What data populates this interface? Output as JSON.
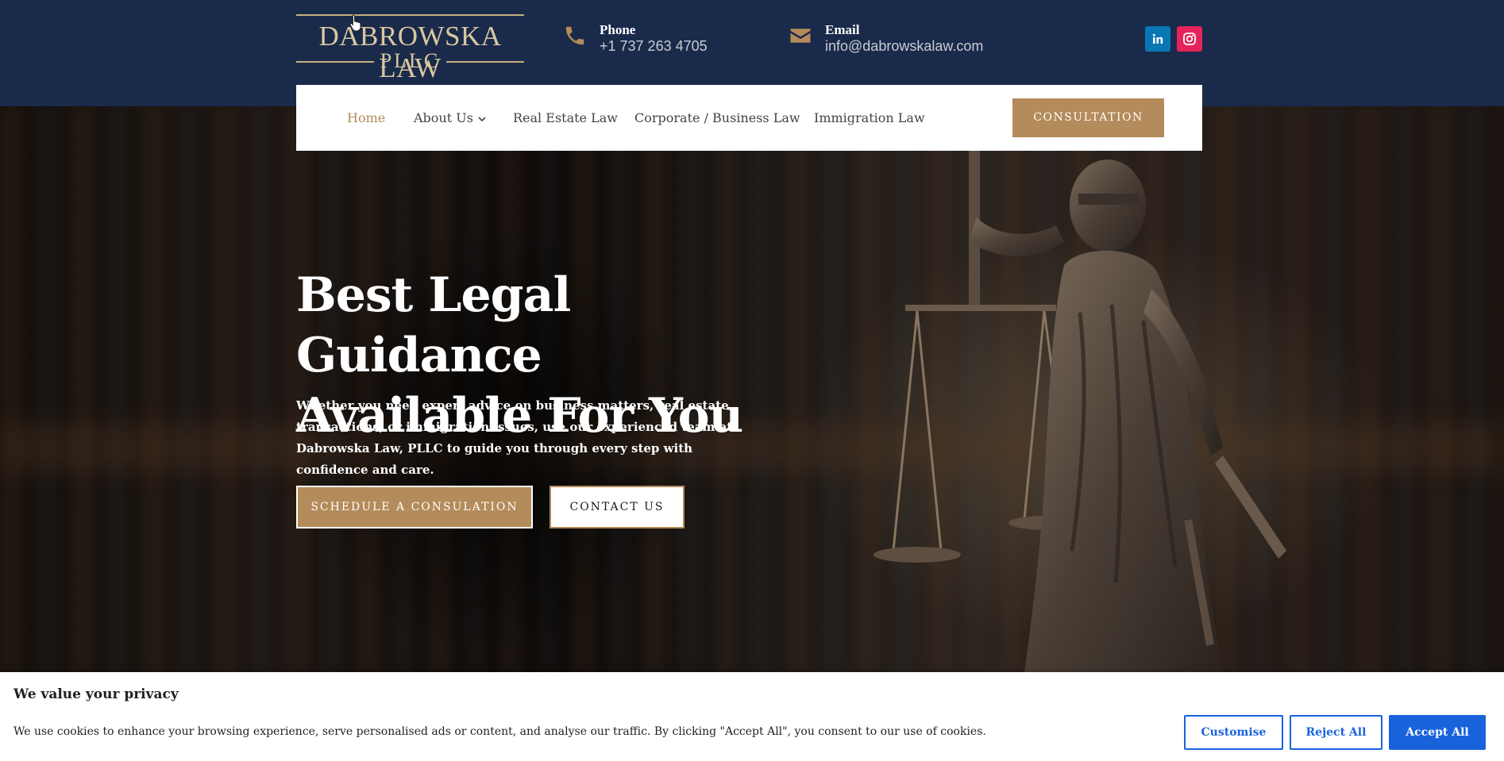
{
  "header": {
    "logo_name": "DABROWSKA LAW",
    "logo_sub": "PLLC",
    "phone_label": "Phone",
    "phone_value": "+1 737 263 4705",
    "email_label": "Email",
    "email_value": "info@dabrowskalaw.com",
    "social": [
      "linkedin-icon",
      "instagram-icon"
    ],
    "colors": {
      "bar": "#1a2a4a",
      "accent": "#b48b5a"
    }
  },
  "nav": {
    "items": [
      {
        "label": "Home",
        "active": true
      },
      {
        "label": "About Us",
        "has_dropdown": true
      },
      {
        "label": "Real Estate Law"
      },
      {
        "label": "Corporate / Business Law"
      },
      {
        "label": "Immigration Law"
      }
    ],
    "cta_label": "CONSULTATION"
  },
  "hero": {
    "title_line1": "Best Legal Guidance",
    "title_line2": "Available For You",
    "text": "Whether you need expert advice on business matters, real estate transactions, or immigration issues, use our experienced team at Dabrowska Law, PLLC to guide you through every step with confidence and care.",
    "primary_button": "SCHEDULE A CONSULATION",
    "secondary_button": "CONTACT US"
  },
  "cookie": {
    "title": "We value your privacy",
    "text": "We use cookies to enhance your browsing experience, serve personalised ads or content, and analyse our traffic. By clicking \"Accept All\", you consent to our use of cookies.",
    "customise": "Customise",
    "reject": "Reject All",
    "accept": "Accept All",
    "accent": "#1863dc"
  }
}
